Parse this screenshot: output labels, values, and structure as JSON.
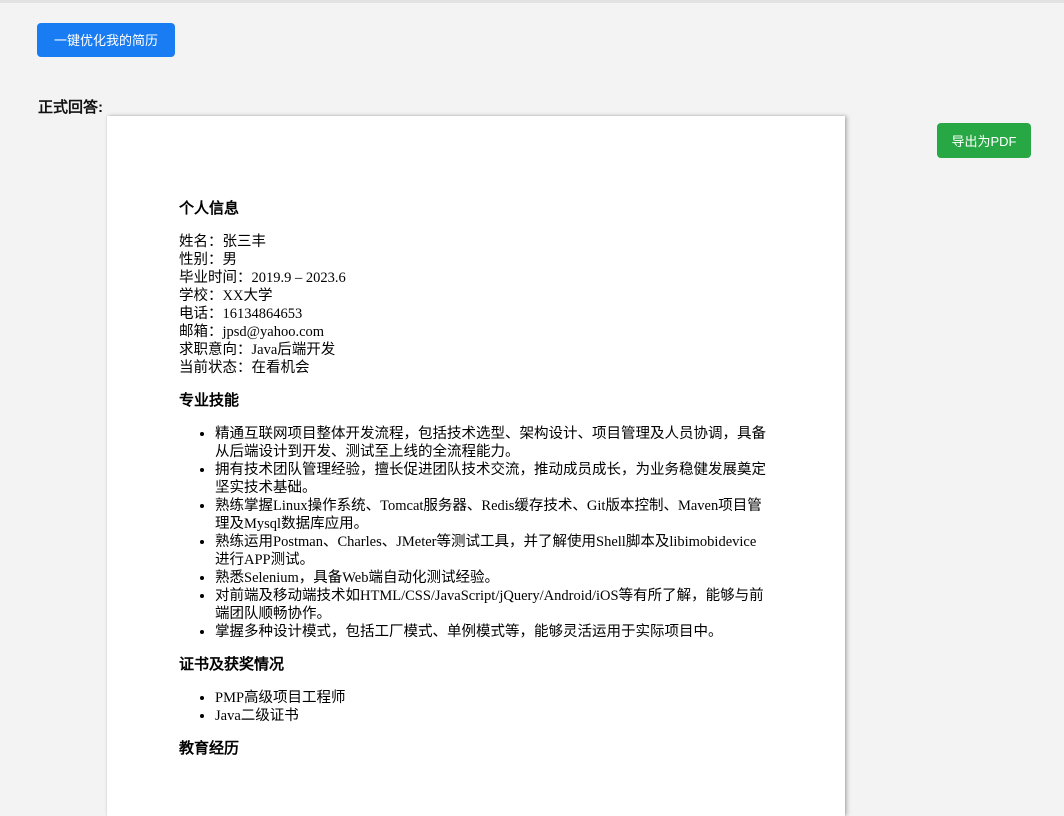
{
  "toolbar": {
    "optimize_label": "一键优化我的简历",
    "export_label": "导出为PDF"
  },
  "answer_label": "正式回答:",
  "colors": {
    "optimize_button": "#1a7cf2",
    "export_button": "#28a745",
    "page_background": "#f3f3f3"
  },
  "resume": {
    "personal_info": {
      "title": "个人信息",
      "lines": [
        "姓名：张三丰",
        "性别：男",
        "毕业时间：2019.9 – 2023.6",
        "学校：XX大学",
        "电话：16134864653",
        "邮箱：jpsd@yahoo.com",
        "求职意向：Java后端开发",
        "当前状态：在看机会"
      ]
    },
    "skills": {
      "title": "专业技能",
      "items": [
        "精通互联网项目整体开发流程，包括技术选型、架构设计、项目管理及人员协调，具备从后端设计到开发、测试至上线的全流程能力。",
        "拥有技术团队管理经验，擅长促进团队技术交流，推动成员成长，为业务稳健发展奠定坚实技术基础。",
        "熟练掌握Linux操作系统、Tomcat服务器、Redis缓存技术、Git版本控制、Maven项目管理及Mysql数据库应用。",
        "熟练运用Postman、Charles、JMeter等测试工具，并了解使用Shell脚本及libimobidevice进行APP测试。",
        "熟悉Selenium，具备Web端自动化测试经验。",
        "对前端及移动端技术如HTML/CSS/JavaScript/jQuery/Android/iOS等有所了解，能够与前端团队顺畅协作。",
        "掌握多种设计模式，包括工厂模式、单例模式等，能够灵活运用于实际项目中。"
      ]
    },
    "certificates": {
      "title": "证书及获奖情况",
      "items": [
        "PMP高级项目工程师",
        "Java二级证书"
      ]
    },
    "education": {
      "title": "教育经历"
    }
  }
}
